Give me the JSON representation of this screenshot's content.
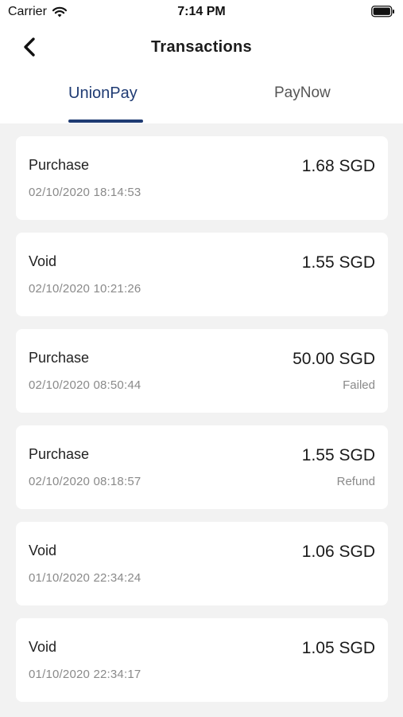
{
  "status_bar": {
    "carrier": "Carrier",
    "time": "7:14 PM"
  },
  "nav": {
    "title": "Transactions"
  },
  "tabs": [
    {
      "label": "UnionPay",
      "active": true
    },
    {
      "label": "PayNow",
      "active": false
    }
  ],
  "colors": {
    "accent": "#1f3b73",
    "background": "#f2f2f2",
    "card": "#ffffff",
    "muted_text": "#8a8a8a"
  },
  "transactions": [
    {
      "type": "Purchase",
      "datetime": "02/10/2020 18:14:53",
      "amount": "1.68 SGD",
      "status": ""
    },
    {
      "type": "Void",
      "datetime": "02/10/2020 10:21:26",
      "amount": "1.55 SGD",
      "status": ""
    },
    {
      "type": "Purchase",
      "datetime": "02/10/2020 08:50:44",
      "amount": "50.00 SGD",
      "status": "Failed"
    },
    {
      "type": "Purchase",
      "datetime": "02/10/2020 08:18:57",
      "amount": "1.55 SGD",
      "status": "Refund"
    },
    {
      "type": "Void",
      "datetime": "01/10/2020 22:34:24",
      "amount": "1.06 SGD",
      "status": ""
    },
    {
      "type": "Void",
      "datetime": "01/10/2020 22:34:17",
      "amount": "1.05 SGD",
      "status": ""
    }
  ]
}
